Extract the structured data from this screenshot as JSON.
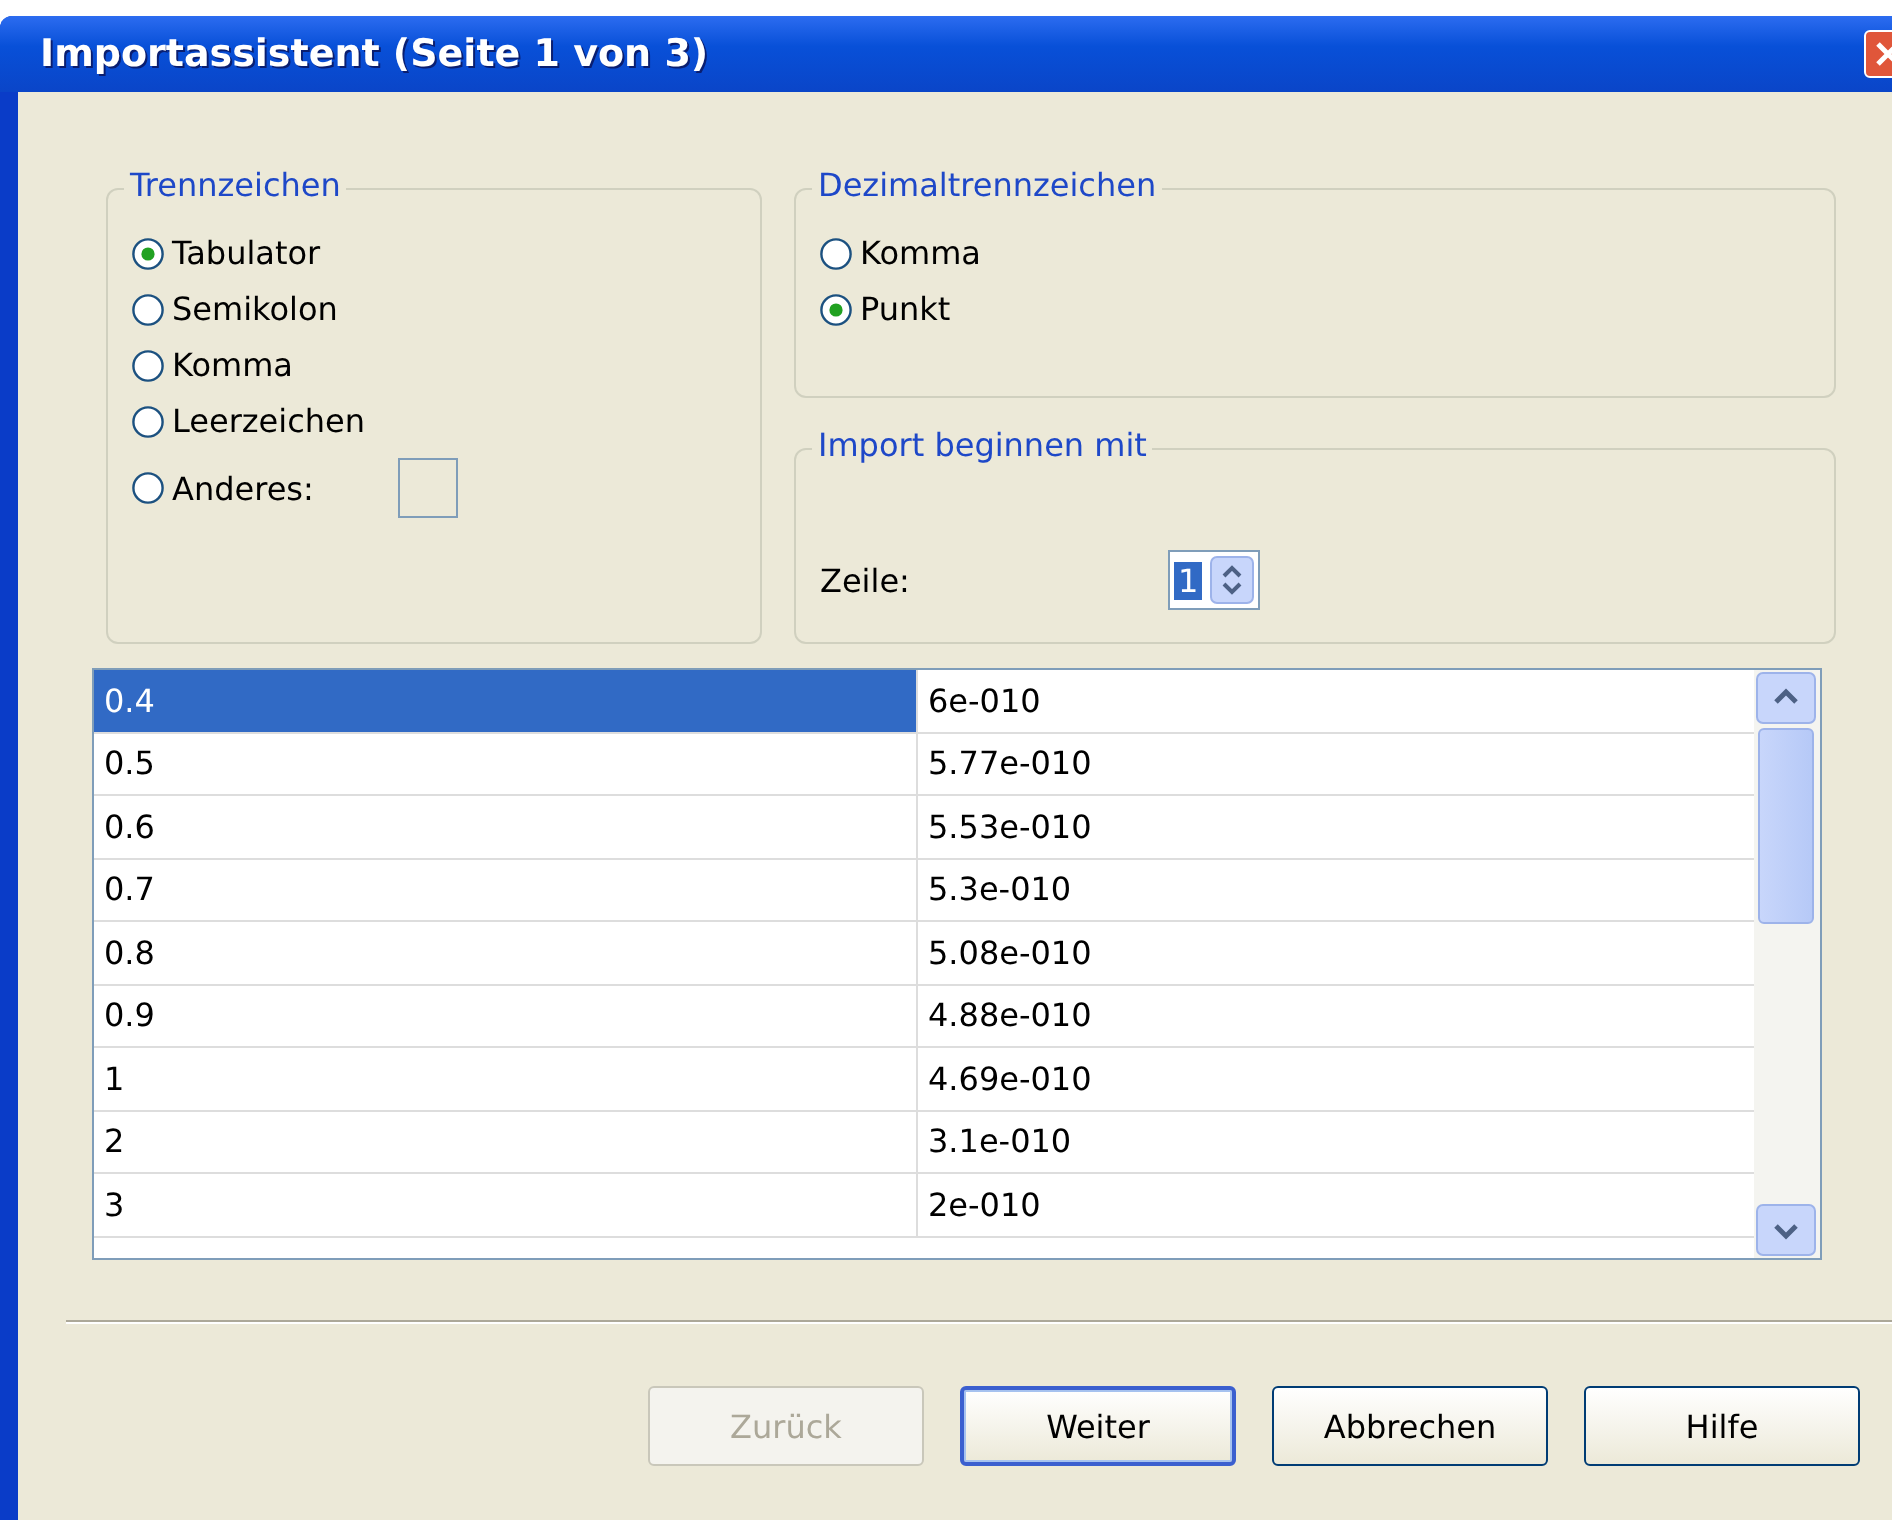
{
  "window": {
    "title": "Importassistent (Seite 1 von 3)"
  },
  "separator_group": {
    "title": "Trennzeichen",
    "options": [
      {
        "label": "Tabulator",
        "selected": true
      },
      {
        "label": "Semikolon",
        "selected": false
      },
      {
        "label": "Komma",
        "selected": false
      },
      {
        "label": "Leerzeichen",
        "selected": false
      },
      {
        "label": "Anderes:",
        "selected": false,
        "kind": "input"
      }
    ]
  },
  "decimal_group": {
    "title": "Dezimaltrennzeichen",
    "options": [
      {
        "label": "Komma",
        "selected": false
      },
      {
        "label": "Punkt",
        "selected": true
      }
    ]
  },
  "start_group": {
    "title": "Import beginnen mit",
    "label": "Zeile:",
    "value": "1"
  },
  "table": {
    "rows": [
      {
        "cells": [
          "0.4",
          "6e-010"
        ],
        "selected": true
      },
      {
        "cells": [
          "0.5",
          "5.77e-010"
        ],
        "selected": false
      },
      {
        "cells": [
          "0.6",
          "5.53e-010"
        ],
        "selected": false
      },
      {
        "cells": [
          "0.7",
          "5.3e-010"
        ],
        "selected": false
      },
      {
        "cells": [
          "0.8",
          "5.08e-010"
        ],
        "selected": false
      },
      {
        "cells": [
          "0.9",
          "4.88e-010"
        ],
        "selected": false
      },
      {
        "cells": [
          "1",
          "4.69e-010"
        ],
        "selected": false
      },
      {
        "cells": [
          "2",
          "3.1e-010"
        ],
        "selected": false
      },
      {
        "cells": [
          "3",
          "2e-010"
        ],
        "selected": false
      }
    ]
  },
  "buttons": [
    {
      "label": "Zurück",
      "disabled": true,
      "default": false
    },
    {
      "label": "Weiter",
      "disabled": false,
      "default": true
    },
    {
      "label": "Abbrechen",
      "disabled": false,
      "default": false
    },
    {
      "label": "Hilfe",
      "disabled": false,
      "default": false
    }
  ]
}
